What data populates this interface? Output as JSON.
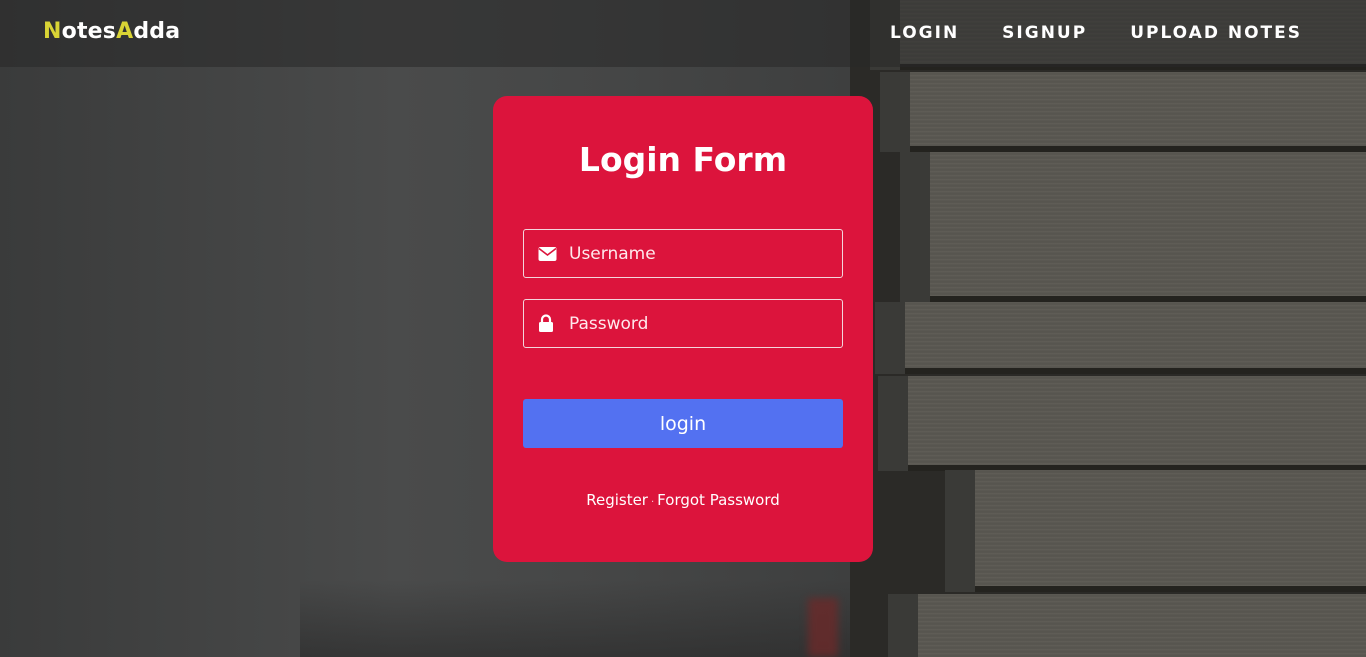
{
  "brand": {
    "prefix_accent": "N",
    "part1": "otes",
    "mid_accent": "A",
    "part2": "dda",
    "accent_color": "#d9d435"
  },
  "nav": {
    "items": [
      {
        "label": "LOGIN"
      },
      {
        "label": "SIGNUP"
      },
      {
        "label": "UPLOAD NOTES"
      }
    ]
  },
  "form": {
    "title": "Login Form",
    "username": {
      "placeholder": "Username",
      "value": "",
      "icon": "envelope-icon"
    },
    "password": {
      "placeholder": "Password",
      "value": "",
      "icon": "lock-icon"
    },
    "submit_label": "login",
    "register_label": "Register",
    "separator": "·",
    "forgot_label": "Forgot Password"
  },
  "colors": {
    "card": "#dc143c",
    "button": "#5371f1",
    "text": "#ffffff"
  }
}
